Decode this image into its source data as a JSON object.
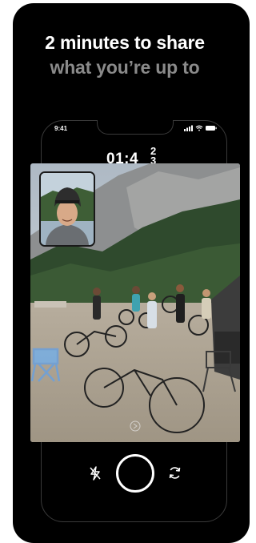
{
  "headline": {
    "line1": "2 minutes to share",
    "line2": "what you’re up to"
  },
  "phone": {
    "status_time": "9:41",
    "timer_main": "01:4",
    "timer_superscript": "2\n3"
  },
  "icons": {
    "flash": "flash-off-icon",
    "shutter": "shutter-button",
    "switch_camera": "switch-camera-icon"
  }
}
